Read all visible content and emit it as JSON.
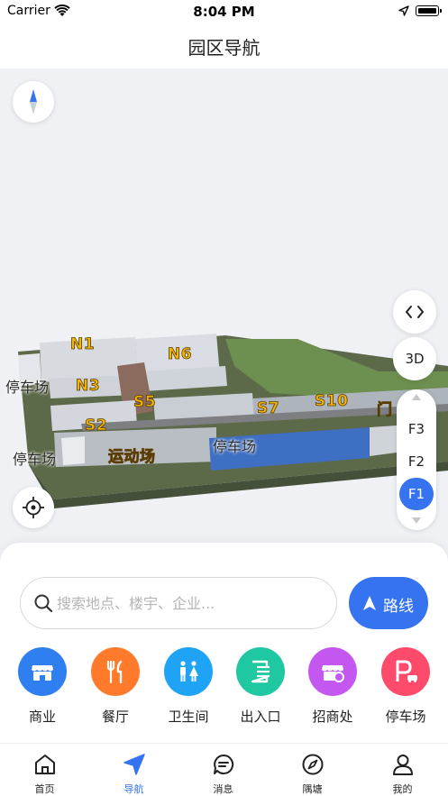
{
  "status_bar": {
    "carrier": "Carrier",
    "time": "8:04 PM"
  },
  "header": {
    "title": "园区导航"
  },
  "map": {
    "building_labels": [
      "N1",
      "N6",
      "N3",
      "S5",
      "S2",
      "S7",
      "S10",
      "门"
    ],
    "area_labels": [
      "停车场",
      "停车场",
      "运动场",
      "停车场"
    ],
    "view_toggle_label": "3D",
    "floors": [
      "F3",
      "F2",
      "F1"
    ],
    "active_floor": "F1"
  },
  "search": {
    "placeholder": "搜索地点、楼宇、企业...",
    "value": "",
    "route_button": "路线"
  },
  "categories": [
    {
      "label": "商业",
      "icon": "shop-icon",
      "color": "#2f7ff0"
    },
    {
      "label": "餐厅",
      "icon": "restaurant-icon",
      "color": "#ff7a2b"
    },
    {
      "label": "卫生间",
      "icon": "restroom-icon",
      "color": "#1fa3f5"
    },
    {
      "label": "出入口",
      "icon": "entrance-icon",
      "color": "#1fc8a0"
    },
    {
      "label": "招商处",
      "icon": "investment-icon",
      "color": "#c357f0"
    },
    {
      "label": "停车场",
      "icon": "parking-icon",
      "color": "#ff4b6b"
    }
  ],
  "tabs": [
    {
      "label": "首页",
      "icon": "home-icon"
    },
    {
      "label": "导航",
      "icon": "navigation-icon"
    },
    {
      "label": "消息",
      "icon": "message-icon"
    },
    {
      "label": "隅塘",
      "icon": "compass-icon"
    },
    {
      "label": "我的",
      "icon": "profile-icon"
    }
  ],
  "active_tab": "导航",
  "colors": {
    "accent": "#3573f0",
    "building_label": "#f2b705"
  }
}
